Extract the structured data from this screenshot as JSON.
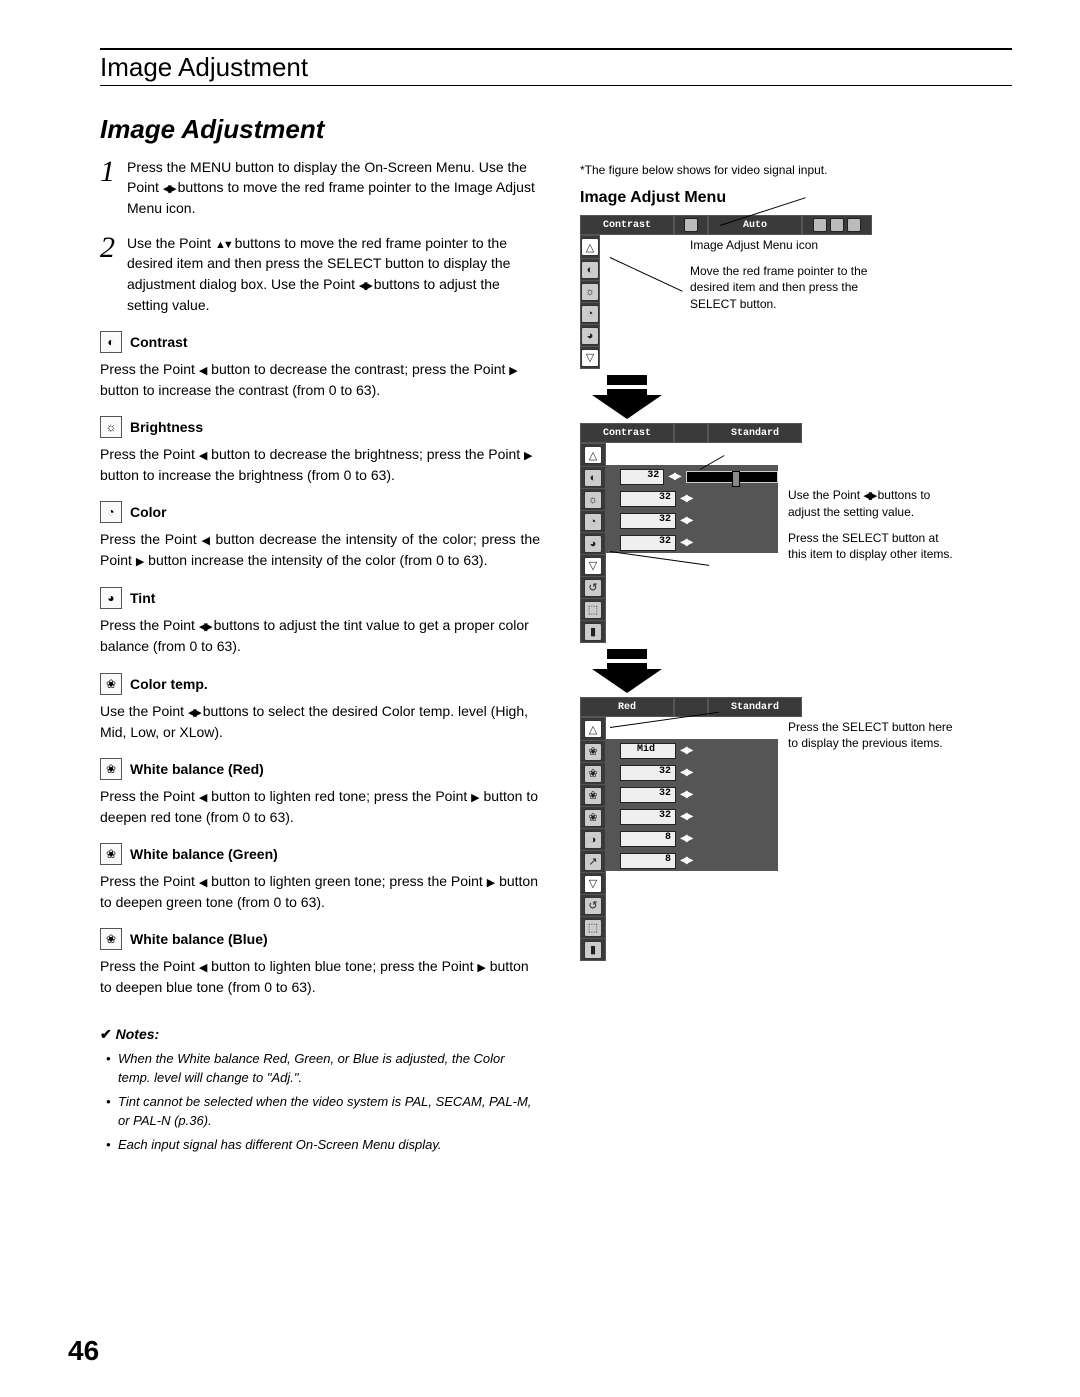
{
  "header": {
    "title": "Image Adjustment"
  },
  "section": {
    "title": "Image Adjustment"
  },
  "steps": [
    {
      "num": "1",
      "body_a": "Press the MENU button to display the On-Screen Menu. Use the Point ",
      "body_b": " buttons to move the red frame pointer to the Image Adjust Menu icon."
    },
    {
      "num": "2",
      "body_a": "Use the Point ",
      "body_b": " buttons to move the red frame pointer to the desired item and then press the SELECT button to display the adjustment dialog box. Use the Point ",
      "body_c": " buttons to adjust the setting value."
    }
  ],
  "items": {
    "contrast": {
      "label": "Contrast",
      "body_a": "Press the Point ",
      "body_b": " button to decrease the contrast; press the Point ",
      "body_c": " button to increase the contrast (from 0 to 63)."
    },
    "brightness": {
      "label": "Brightness",
      "body_a": "Press the Point ",
      "body_b": " button to decrease the brightness; press the Point ",
      "body_c": " button to increase the brightness (from 0 to 63)."
    },
    "color": {
      "label": "Color",
      "body_a": "Press the Point ",
      "body_b": " button decrease the intensity of the color; press the Point ",
      "body_c": " button increase the intensity of the color (from 0 to 63)."
    },
    "tint": {
      "label": "Tint",
      "body_a": "Press the Point ",
      "body_b": " buttons to adjust the tint value to get a proper color balance (from 0 to 63)."
    },
    "colortemp": {
      "label": "Color temp.",
      "body_a": "Use the Point ",
      "body_b": " buttons to select the desired Color temp. level (High, Mid, Low, or XLow)."
    },
    "wb_red": {
      "label": "White balance (Red)",
      "body_a": "Press the Point ",
      "body_b": " button to lighten red tone; press the Point ",
      "body_c": " button to deepen red tone (from 0 to 63)."
    },
    "wb_green": {
      "label": "White balance (Green)",
      "body_a": "Press the Point ",
      "body_b": " button to lighten green tone; press the Point ",
      "body_c": " button to deepen green tone (from 0 to 63)."
    },
    "wb_blue": {
      "label": "White balance (Blue)",
      "body_a": "Press the Point ",
      "body_b": " button to lighten blue tone; press the Point ",
      "body_c": " button to deepen blue tone (from 0 to 63)."
    }
  },
  "notes": {
    "head": "Notes:",
    "n1": "When the White balance Red, Green, or Blue is adjusted, the Color temp. level will change to \"Adj.\".",
    "n2": "Tint cannot be selected when the video system is PAL, SECAM, PAL-M, or PAL-N (p.36).",
    "n3": "Each input signal has different On-Screen Menu display."
  },
  "page": {
    "num": "46"
  },
  "right": {
    "caption": "*The figure below shows for video signal input.",
    "heading": "Image Adjust Menu",
    "menu1": {
      "title": "Contrast",
      "mode": "Auto",
      "note_icon": "Image Adjust Menu icon",
      "note_frame": "Move the red frame pointer to the desired item and then press the SELECT button."
    },
    "menu2": {
      "title": "Contrast",
      "mode": "Standard",
      "values": [
        "32",
        "32",
        "32",
        "32"
      ],
      "note_adjust_a": "Use the Point ",
      "note_adjust_b": " buttons to adjust the setting value.",
      "note_select": "Press the SELECT button at this item to display other items."
    },
    "menu3": {
      "title": "Red",
      "mode": "Standard",
      "midval": "Mid",
      "values": [
        "32",
        "32",
        "32",
        "8",
        "8"
      ],
      "note_prev": "Press the SELECT button here to display the previous items."
    }
  }
}
